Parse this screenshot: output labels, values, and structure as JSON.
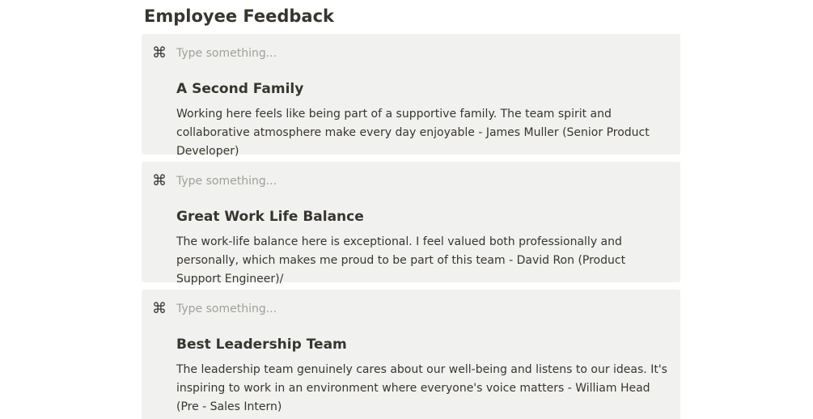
{
  "page": {
    "title": "Employee Feedback"
  },
  "feedback": [
    {
      "icon": "command-icon",
      "icon_glyph": "⌘",
      "placeholder": "Type something...",
      "title": "A Second Family",
      "body": "Working here feels like being part of a supportive family. The team spirit and collaborative atmosphere make every day enjoyable - James Muller (Senior Product Developer)"
    },
    {
      "icon": "command-icon",
      "icon_glyph": "⌘",
      "placeholder": "Type something...",
      "title": "Great Work Life Balance",
      "body": "The work-life balance here is exceptional. I feel valued both professionally and personally, which makes me proud to be part of this team - David Ron (Product Support Engineer)/"
    },
    {
      "icon": "command-icon",
      "icon_glyph": "⌘",
      "placeholder": "Type something...",
      "title": "Best Leadership Team",
      "body": "The leadership team genuinely cares about our well-being and listens to our ideas. It's inspiring to work in an environment where everyone's voice matters - William Head (Pre - Sales Intern)"
    }
  ],
  "colors": {
    "background": "#ffffff",
    "card_background": "#f1f1ef",
    "text": "#37352f",
    "placeholder": "#a19f9a"
  }
}
